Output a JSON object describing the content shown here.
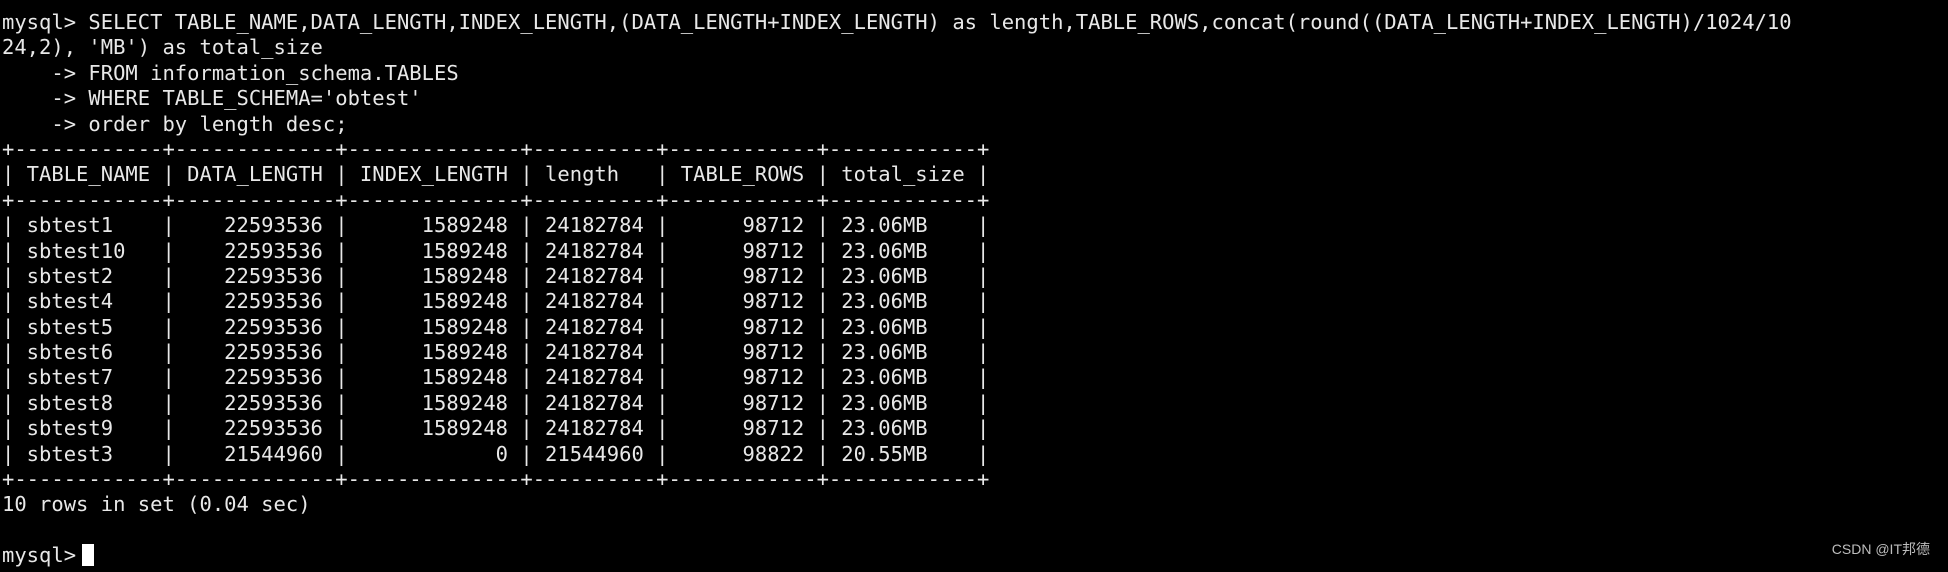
{
  "terminal": {
    "command_lines": [
      "mysql> SELECT TABLE_NAME,DATA_LENGTH,INDEX_LENGTH,(DATA_LENGTH+INDEX_LENGTH) as length,TABLE_ROWS,concat(round((DATA_LENGTH+INDEX_LENGTH)/1024/10",
      "24,2), 'MB') as total_size",
      "    -> FROM information_schema.TABLES",
      "    -> WHERE TABLE_SCHEMA='obtest'",
      "    -> order by length desc;"
    ],
    "table": {
      "border": "+------------+-------------+--------------+----------+------------+------------+",
      "header_line": "| TABLE_NAME | DATA_LENGTH | INDEX_LENGTH | length   | TABLE_ROWS | total_size |",
      "columns": [
        "TABLE_NAME",
        "DATA_LENGTH",
        "INDEX_LENGTH",
        "length",
        "TABLE_ROWS",
        "total_size"
      ],
      "rows": [
        [
          "sbtest1",
          "22593536",
          "1589248",
          "24182784",
          "98712",
          "23.06MB"
        ],
        [
          "sbtest10",
          "22593536",
          "1589248",
          "24182784",
          "98712",
          "23.06MB"
        ],
        [
          "sbtest2",
          "22593536",
          "1589248",
          "24182784",
          "98712",
          "23.06MB"
        ],
        [
          "sbtest4",
          "22593536",
          "1589248",
          "24182784",
          "98712",
          "23.06MB"
        ],
        [
          "sbtest5",
          "22593536",
          "1589248",
          "24182784",
          "98712",
          "23.06MB"
        ],
        [
          "sbtest6",
          "22593536",
          "1589248",
          "24182784",
          "98712",
          "23.06MB"
        ],
        [
          "sbtest7",
          "22593536",
          "1589248",
          "24182784",
          "98712",
          "23.06MB"
        ],
        [
          "sbtest8",
          "22593536",
          "1589248",
          "24182784",
          "98712",
          "23.06MB"
        ],
        [
          "sbtest9",
          "22593536",
          "1589248",
          "24182784",
          "98712",
          "23.06MB"
        ],
        [
          "sbtest3",
          "21544960",
          "0",
          "21544960",
          "98822",
          "20.55MB"
        ]
      ],
      "row_lines": [
        "| sbtest1    |    22593536 |      1589248 | 24182784 |      98712 | 23.06MB    |",
        "| sbtest10   |    22593536 |      1589248 | 24182784 |      98712 | 23.06MB    |",
        "| sbtest2    |    22593536 |      1589248 | 24182784 |      98712 | 23.06MB    |",
        "| sbtest4    |    22593536 |      1589248 | 24182784 |      98712 | 23.06MB    |",
        "| sbtest5    |    22593536 |      1589248 | 24182784 |      98712 | 23.06MB    |",
        "| sbtest6    |    22593536 |      1589248 | 24182784 |      98712 | 23.06MB    |",
        "| sbtest7    |    22593536 |      1589248 | 24182784 |      98712 | 23.06MB    |",
        "| sbtest8    |    22593536 |      1589248 | 24182784 |      98712 | 23.06MB    |",
        "| sbtest9    |    22593536 |      1589248 | 24182784 |      98712 | 23.06MB    |",
        "| sbtest3    |    21544960 |            0 | 21544960 |      98822 | 20.55MB    |"
      ]
    },
    "result_summary": "10 rows in set (0.04 sec)",
    "prompt": "mysql>",
    "colors": {
      "background": "#000000",
      "text": "#e8e8e8",
      "cursor": "#ffffff"
    }
  },
  "watermark": "CSDN @IT邦德"
}
